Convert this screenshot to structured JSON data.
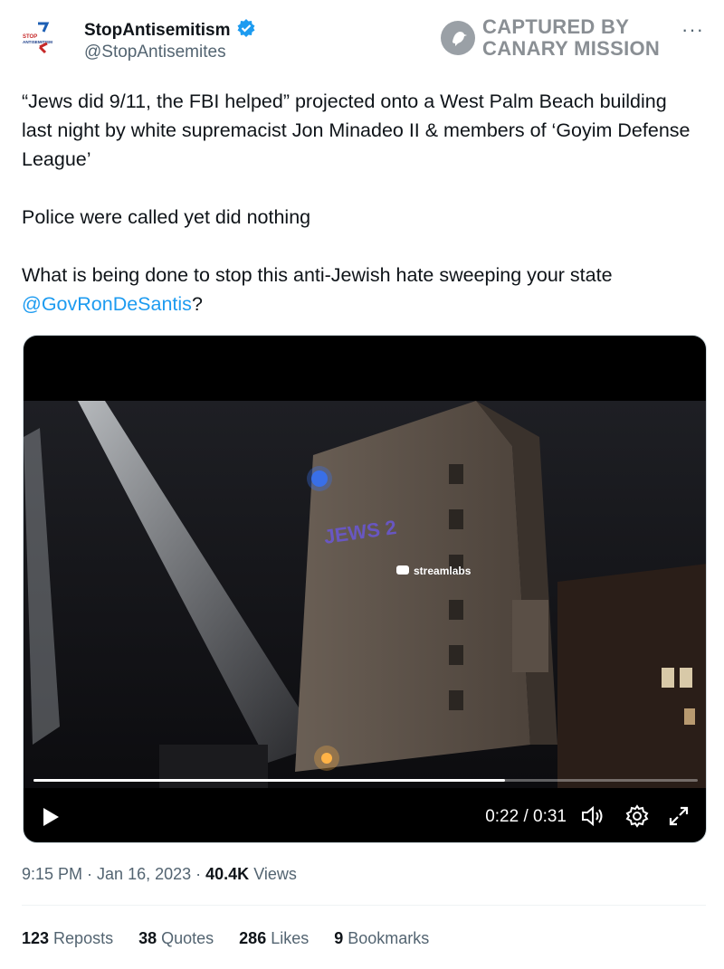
{
  "author": {
    "display_name": "StopAntisemitism",
    "handle": "@StopAntisemites",
    "avatar_text_top": "STOP",
    "avatar_text_bottom": "ANTISEMITISM"
  },
  "watermark": {
    "line1": "CAPTURED BY",
    "line2": "CANARY MISSION"
  },
  "more_label": "···",
  "tweet": {
    "para1": "“Jews did 9/11, the FBI helped” projected onto a West Palm Beach building last night by white supremacist Jon Minadeo II & members of ‘Goyim Defense League’",
    "para2": "Police were called yet did nothing",
    "para3": "What is being done to stop this anti-Jewish hate sweeping your state ",
    "mention": "@GovRonDeSantis",
    "para3_end": "?"
  },
  "video": {
    "projected_text": "JEWS 2",
    "stream_label": "streamlabs",
    "time": "0:22 / 0:31",
    "progress": 0.71
  },
  "meta": {
    "time": "9:15 PM",
    "date": "Jan 16, 2023",
    "views_count": "40.4K",
    "views_label": " Views"
  },
  "stats": {
    "reposts_count": "123",
    "reposts_label": " Reposts",
    "quotes_count": "38",
    "quotes_label": " Quotes",
    "likes_count": "286",
    "likes_label": " Likes",
    "bookmarks_count": "9",
    "bookmarks_label": " Bookmarks"
  },
  "colors": {
    "accent": "#1d9bf0",
    "secondary_text": "#536471"
  }
}
